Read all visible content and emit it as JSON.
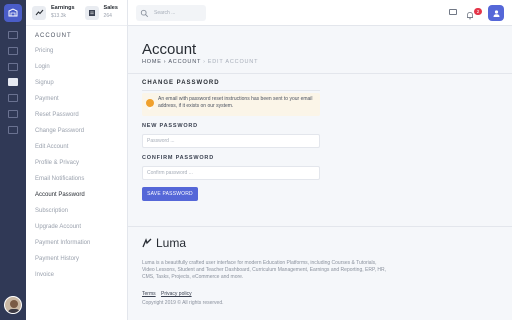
{
  "stats": [
    {
      "label": "Earnings",
      "value": "$13.3k",
      "icon": "trending-up-icon"
    },
    {
      "label": "Sales",
      "value": "264",
      "icon": "receipt-icon"
    }
  ],
  "sidebar": {
    "section": "ACCOUNT",
    "items": [
      "Pricing",
      "Login",
      "Signup",
      "Payment",
      "Reset Password",
      "Change Password",
      "Edit Account",
      "Profile & Privacy",
      "Email Notifications",
      "Account Password",
      "Subscription",
      "Upgrade Account",
      "Payment Information",
      "Payment History",
      "Invoice"
    ],
    "active_index": 9
  },
  "topbar": {
    "search_placeholder": "Search ...",
    "notification_count": "2"
  },
  "page": {
    "title": "Account",
    "breadcrumb": {
      "home": "HOME",
      "sep": "›",
      "parent": "ACCOUNT",
      "current": "EDIT ACCOUNT"
    }
  },
  "change_password": {
    "title": "CHANGE PASSWORD",
    "alert": "An email with password reset instructions has been sent to your email address, if it exists on our system.",
    "new_label": "NEW PASSWORD",
    "new_placeholder": "Password ...",
    "confirm_label": "CONFIRM PASSWORD",
    "confirm_placeholder": "Confirm password ...",
    "save_label": "SAVE PASSWORD"
  },
  "footer": {
    "brand": "Luma",
    "description": "Luma is a beautifully crafted user interface for modern Education Platforms, including Courses & Tutorials, Video Lessons, Student and Teacher Dashboard, Curriculum Management, Earnings and Reporting, ERP, HR, CMS, Tasks, Projects, eCommerce and more.",
    "terms": "Terms",
    "privacy": "Privacy policy",
    "copyright": "Copyright 2019 © All rights reserved."
  },
  "colors": {
    "accent": "#5567d8",
    "rail": "#303956",
    "badge": "#e4364a",
    "alert_bg": "#fbf5e8",
    "alert_icon": "#f0a02b"
  }
}
